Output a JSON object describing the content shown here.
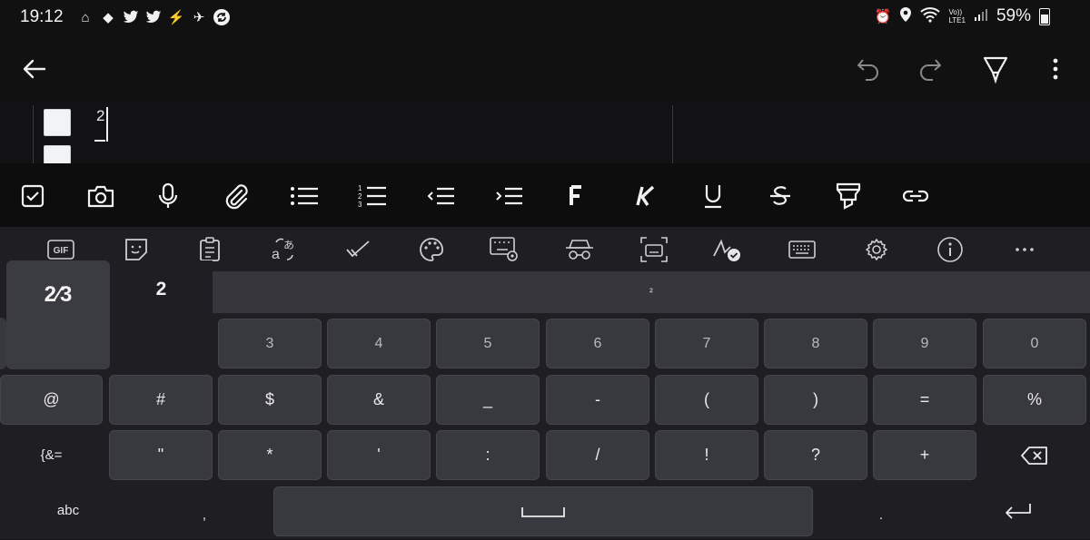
{
  "status": {
    "time": "19:12",
    "battery": "59%",
    "network": "LTE1",
    "volte": "Vo))",
    "icons_left": [
      "home-app-icon",
      "cloud-icon",
      "twitter-icon",
      "twitter-icon",
      "bolt-icon",
      "plane-icon",
      "sync-icon"
    ]
  },
  "note": {
    "line1": "2"
  },
  "suggestions": {
    "fraction": "2⁄3",
    "plain": "2",
    "superscript": "²"
  },
  "keyboard": {
    "row1": [
      "3",
      "4",
      "5",
      "6",
      "7",
      "8",
      "9",
      "0"
    ],
    "row2": [
      "@",
      "#",
      "$",
      "&",
      "_",
      "-",
      "(",
      ")",
      "=",
      "%"
    ],
    "row3_left": "{&=",
    "row3": [
      "\"",
      "*",
      "'",
      ":",
      "/",
      "!",
      "?",
      "+"
    ],
    "row4": {
      "abc": "abc",
      "comma": ",",
      "period": "."
    }
  }
}
